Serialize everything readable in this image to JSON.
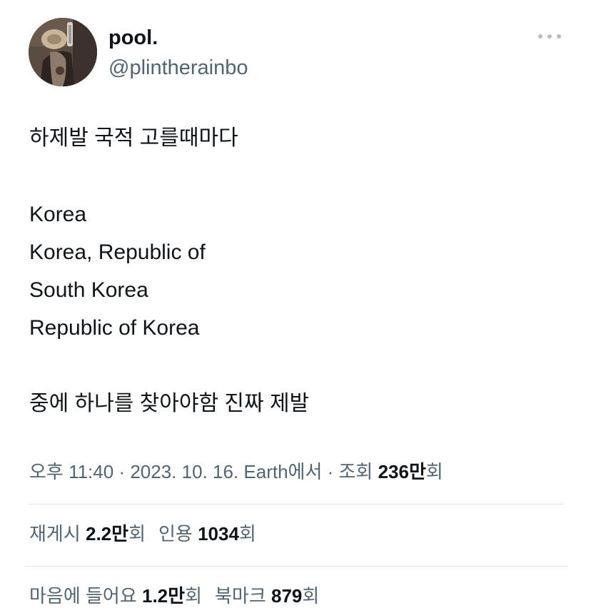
{
  "author": {
    "display_name": "pool.",
    "handle": "@plintherainbo"
  },
  "icons": {
    "more": "more-horizontal-icon",
    "avatar": "profile-photo"
  },
  "tweet": {
    "lines": [
      "하제발 국적 고를때마다",
      "Korea",
      "Korea, Republic of",
      "South Korea",
      "Republic of Korea",
      "중에 하나를 찾아야함 진짜 제발"
    ]
  },
  "meta": {
    "time": "오후 11:40",
    "separator": "·",
    "date": "2023. 10. 16.",
    "source": "Earth에서",
    "views_label": "조회",
    "views_value": "236만",
    "views_suffix": "회"
  },
  "stats": {
    "retweets_label": "재게시",
    "retweets_value": "2.2만",
    "retweets_suffix": "회",
    "quotes_label": "인용",
    "quotes_value": "1034",
    "quotes_suffix": "회",
    "likes_label": "마음에 들어요",
    "likes_value": "1.2만",
    "likes_suffix": "회",
    "bookmarks_label": "북마크",
    "bookmarks_value": "879",
    "bookmarks_suffix": "회"
  },
  "colors": {
    "text": "#0f1419",
    "secondary": "#536471",
    "divider": "#e1e6ea"
  }
}
